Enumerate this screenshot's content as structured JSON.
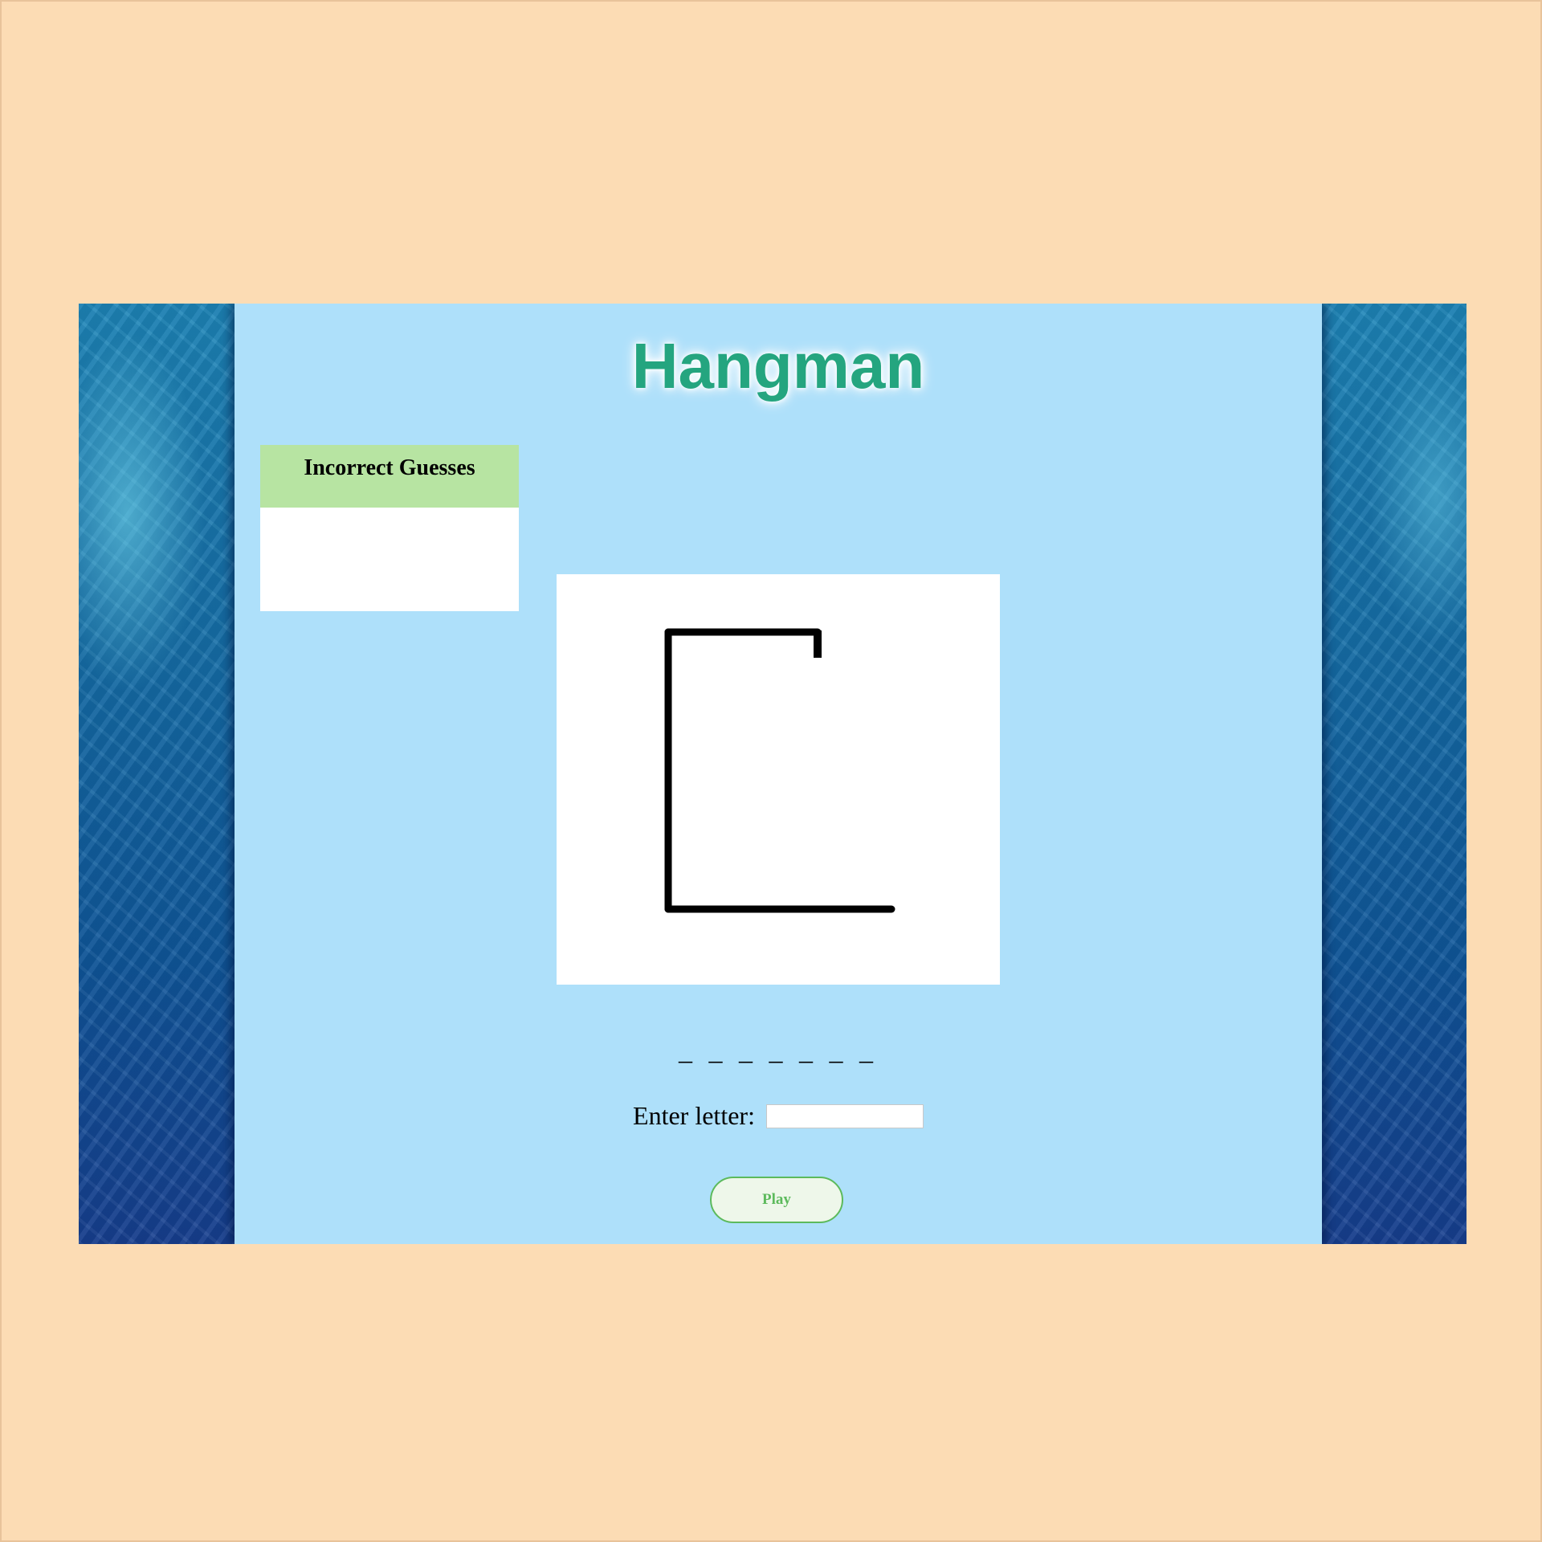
{
  "app": {
    "title": "Hangman"
  },
  "incorrect_guesses": {
    "header": "Incorrect Guesses",
    "letters": ""
  },
  "word": {
    "blanks": "_ _ _ _ _ _ _"
  },
  "entry": {
    "label": "Enter letter:",
    "value": "",
    "placeholder": ""
  },
  "play_button": {
    "label": "Play"
  },
  "colors": {
    "page_background": "#fcdcb4",
    "panel_background": "#aee0fa",
    "title": "#24a57f",
    "guesses_header": "#b7e4a2",
    "play_button_accent": "#5cba5c"
  }
}
